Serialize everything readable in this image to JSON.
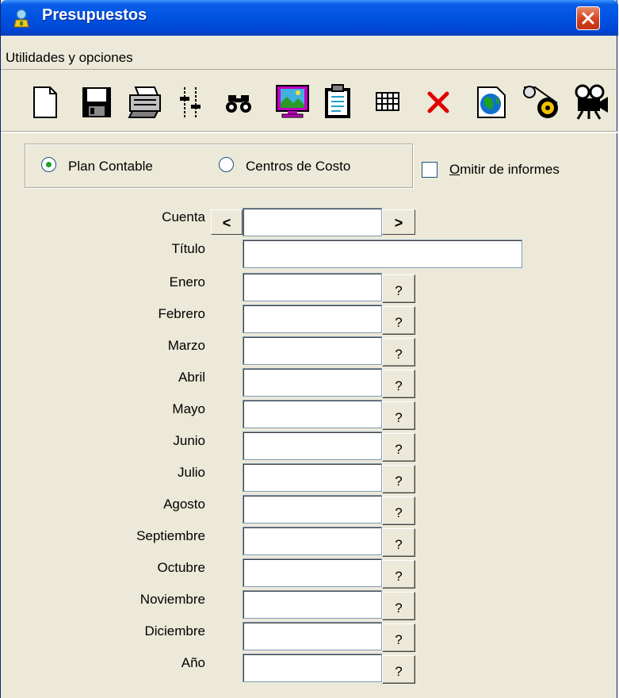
{
  "window": {
    "title": "Presupuestos"
  },
  "menu": {
    "items": [
      "Utilidades y opciones"
    ]
  },
  "toolbar": {
    "buttons": [
      {
        "name": "new-document-icon"
      },
      {
        "name": "save-icon"
      },
      {
        "name": "print-icon"
      },
      {
        "name": "sliders-icon"
      },
      {
        "name": "binoculars-icon"
      },
      {
        "name": "monitor-icon"
      },
      {
        "name": "clipboard-icon"
      },
      {
        "name": "grid-icon"
      },
      {
        "name": "delete-icon"
      },
      {
        "name": "globe-icon"
      },
      {
        "name": "tape-reel-icon"
      },
      {
        "name": "movie-camera-icon"
      }
    ]
  },
  "options": {
    "plan_contable": "Plan Contable",
    "centros_costo": "Centros de Costo",
    "selected": "Plan Contable",
    "omitir": "Omitir de informes",
    "omitir_checked": false
  },
  "form": {
    "cuenta_label": "Cuenta",
    "cuenta_value": "",
    "prev_label": "<",
    "next_label": ">",
    "titulo_label": "Título",
    "titulo_value": "",
    "lookup_label": "?",
    "months": [
      {
        "label": "Enero",
        "value": ""
      },
      {
        "label": "Febrero",
        "value": ""
      },
      {
        "label": "Marzo",
        "value": ""
      },
      {
        "label": "Abril",
        "value": ""
      },
      {
        "label": "Mayo",
        "value": ""
      },
      {
        "label": "Junio",
        "value": ""
      },
      {
        "label": "Julio",
        "value": ""
      },
      {
        "label": "Agosto",
        "value": ""
      },
      {
        "label": "Septiembre",
        "value": ""
      },
      {
        "label": "Octubre",
        "value": ""
      },
      {
        "label": "Noviembre",
        "value": ""
      },
      {
        "label": "Diciembre",
        "value": ""
      },
      {
        "label": "Año",
        "value": ""
      }
    ]
  },
  "colors": {
    "titlebar": "#0054e3",
    "face": "#ece9d8",
    "radio_dot": "#21a121",
    "close": "#d3411e"
  }
}
